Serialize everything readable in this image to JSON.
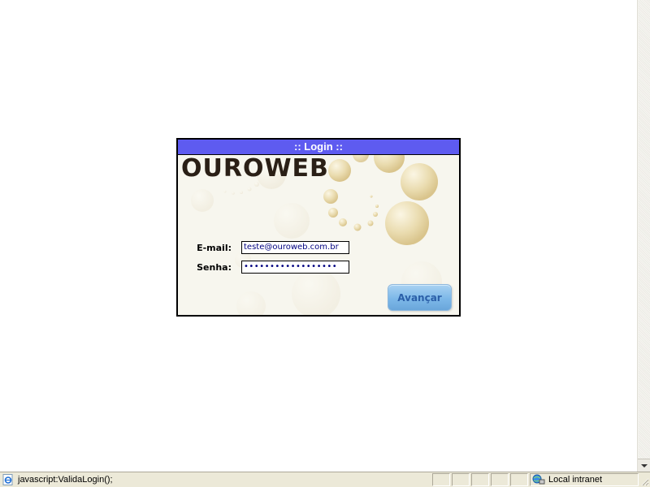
{
  "panel": {
    "title": ":: Login ::",
    "logo": "OUROWEB",
    "email_label": "E-mail:",
    "email_value": "teste@ouroweb.com.br",
    "password_label": "Senha:",
    "password_value": "••••••••••••••••••",
    "submit_label": "Avançar"
  },
  "statusbar": {
    "status_text": "javascript:ValidaLogin();",
    "zone_text": "Local intranet"
  },
  "colors": {
    "title_bar": "#5e5bf0",
    "panel_bg": "#f7f6ee",
    "bubble": "#eadcb0",
    "button": "#7db8e8"
  },
  "icons": [
    "ie-page-icon",
    "local-intranet-icon",
    "resize-grip-icon",
    "scroll-down-arrow-icon"
  ]
}
